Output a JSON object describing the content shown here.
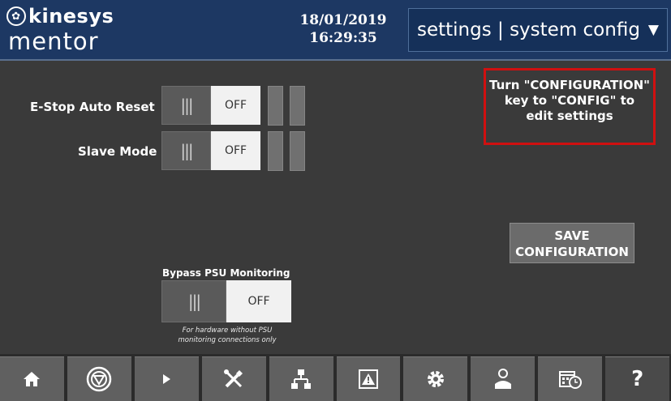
{
  "header": {
    "logo_top": "kinesys",
    "logo_mark": "✿",
    "logo_bottom": "mentor",
    "date": "18/01/2019",
    "time": "16:29:35",
    "title": "settings | system config",
    "title_arrow": "▼"
  },
  "settings": {
    "estop": {
      "label": "E-Stop Auto Reset",
      "grip": "|||",
      "state": "OFF"
    },
    "slave": {
      "label": "Slave Mode",
      "grip": "|||",
      "state": "OFF"
    },
    "bypass": {
      "label": "Bypass PSU Monitoring",
      "grip": "|||",
      "state": "OFF",
      "note_line1": "For hardware without PSU",
      "note_line2": "monitoring connections only"
    }
  },
  "warning": {
    "line1": "Turn \"CONFIGURATION\"",
    "line2": "key to \"CONFIG\" to",
    "line3": "edit settings",
    "border_color": "#d01010"
  },
  "save_button": {
    "line1": "SAVE",
    "line2": "CONFIGURATION"
  },
  "nav": {
    "home": "home-icon",
    "stop": "stop-icon",
    "play": "play-icon",
    "tools": "tools-icon",
    "network": "network-icon",
    "alarm": "alarm-icon",
    "settings": "gear-icon",
    "user": "user-icon",
    "schedule": "schedule-icon",
    "help_label": "?"
  },
  "colors": {
    "header_bg": "#1d3863",
    "body_bg": "#3a3a3a",
    "accent_red": "#d01010"
  }
}
